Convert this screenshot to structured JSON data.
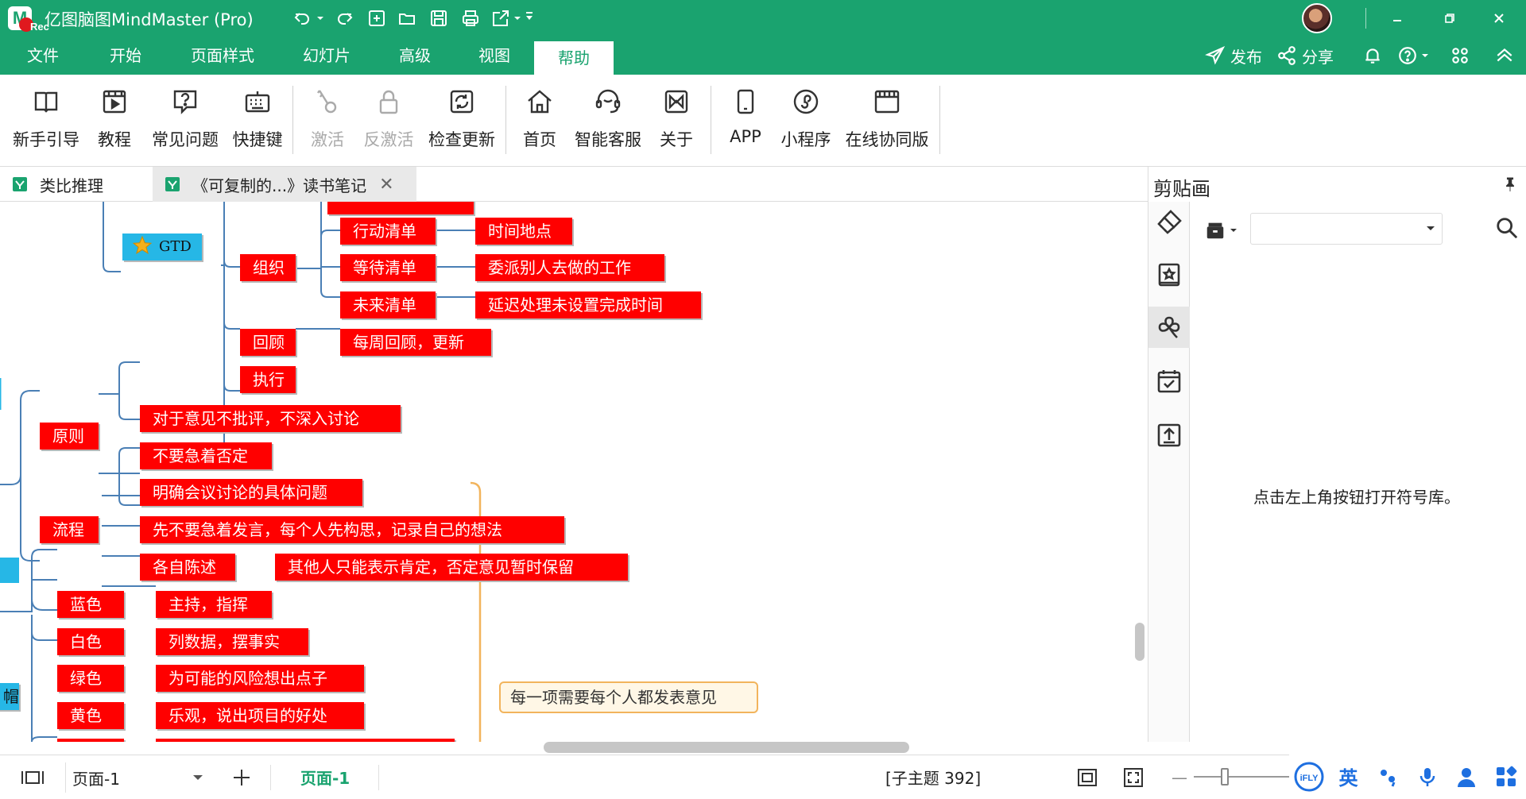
{
  "app": {
    "title": "亿图脑图MindMaster (Pro)",
    "logo_letter": "M",
    "rec_text": "Rec",
    "brand_color": "#1aa36f"
  },
  "quick_access": [
    "undo-icon",
    "redo-icon",
    "new-icon",
    "open-icon",
    "save-icon",
    "print-icon",
    "export-icon",
    "customize-icon"
  ],
  "menu": {
    "tabs": [
      "文件",
      "开始",
      "页面样式",
      "幻灯片",
      "高级",
      "视图",
      "帮助"
    ],
    "active_tab": "帮助",
    "publish_label": "发布",
    "share_label": "分享"
  },
  "ribbon": {
    "buttons": [
      {
        "label": "新手引导",
        "icon": "guide-book-icon",
        "enabled": true
      },
      {
        "label": "教程",
        "icon": "tutorial-video-icon",
        "enabled": true
      },
      {
        "label": "常见问题",
        "icon": "faq-icon",
        "enabled": true
      },
      {
        "label": "快捷键",
        "icon": "keyboard-shortcut-icon",
        "enabled": true
      },
      {
        "label": "激活",
        "icon": "key-icon",
        "enabled": false
      },
      {
        "label": "反激活",
        "icon": "lock-icon",
        "enabled": false
      },
      {
        "label": "检查更新",
        "icon": "update-icon",
        "enabled": true
      },
      {
        "label": "首页",
        "icon": "home-icon",
        "enabled": true
      },
      {
        "label": "智能客服",
        "icon": "customer-service-icon",
        "enabled": true
      },
      {
        "label": "关于",
        "icon": "about-icon",
        "enabled": true
      },
      {
        "label": "APP",
        "icon": "mobile-app-icon",
        "enabled": true
      },
      {
        "label": "小程序",
        "icon": "mini-program-icon",
        "enabled": true
      },
      {
        "label": "在线协同版",
        "icon": "online-collab-icon",
        "enabled": true
      }
    ]
  },
  "doc_tabs": [
    {
      "label": "类比推理",
      "active": false
    },
    {
      "label": "《可复制的...》读书笔记",
      "active": true
    }
  ],
  "mindmap": {
    "nodes": {
      "gtd": "GTD",
      "organize": "组织",
      "action_list": "行动清单",
      "time_place": "时间地点",
      "waiting_list": "等待清单",
      "delegated": "委派别人去做的工作",
      "future_list": "未来清单",
      "deferred": "延迟处理未设置完成时间",
      "review": "回顾",
      "weekly_review": "每周回顾，更新",
      "execute": "执行",
      "principle": "原则",
      "no_criticize": "对于意见不批评，不深入讨论",
      "no_deny": "不要急着否定",
      "process": "流程",
      "clarify": "明确会议讨论的具体问题",
      "think_first": "先不要急着发言，每个人先构思，记录自己的想法",
      "each_state": "各自陈述",
      "only_affirm": "其他人只能表示肯定，否定意见暂时保留",
      "blue": "蓝色",
      "host": "主持，指挥",
      "white": "白色",
      "list_data": "列数据，摆事实",
      "green": "绿色",
      "risk": "为可能的风险想出点子",
      "yellow": "黄色",
      "optimistic": "乐观，说出项目的好处",
      "hat_partial": "帽",
      "note": "每一项需要每个人都发表意见"
    },
    "node_color": "#ff0000",
    "branch_color": "#4a7fb5"
  },
  "right_panel": {
    "title": "剪贴画",
    "hint": "点击左上角按钮打开符号库。",
    "rail_icons": [
      "clipart-brush-icon",
      "favorite-icon",
      "clover-icon",
      "task-check-icon",
      "upload-icon"
    ],
    "active_rail": "clover-icon"
  },
  "status": {
    "page_select": "页面-1",
    "active_page": "页面-1",
    "topic_count": "[子主题 392]"
  },
  "ime": {
    "lang": "英"
  }
}
